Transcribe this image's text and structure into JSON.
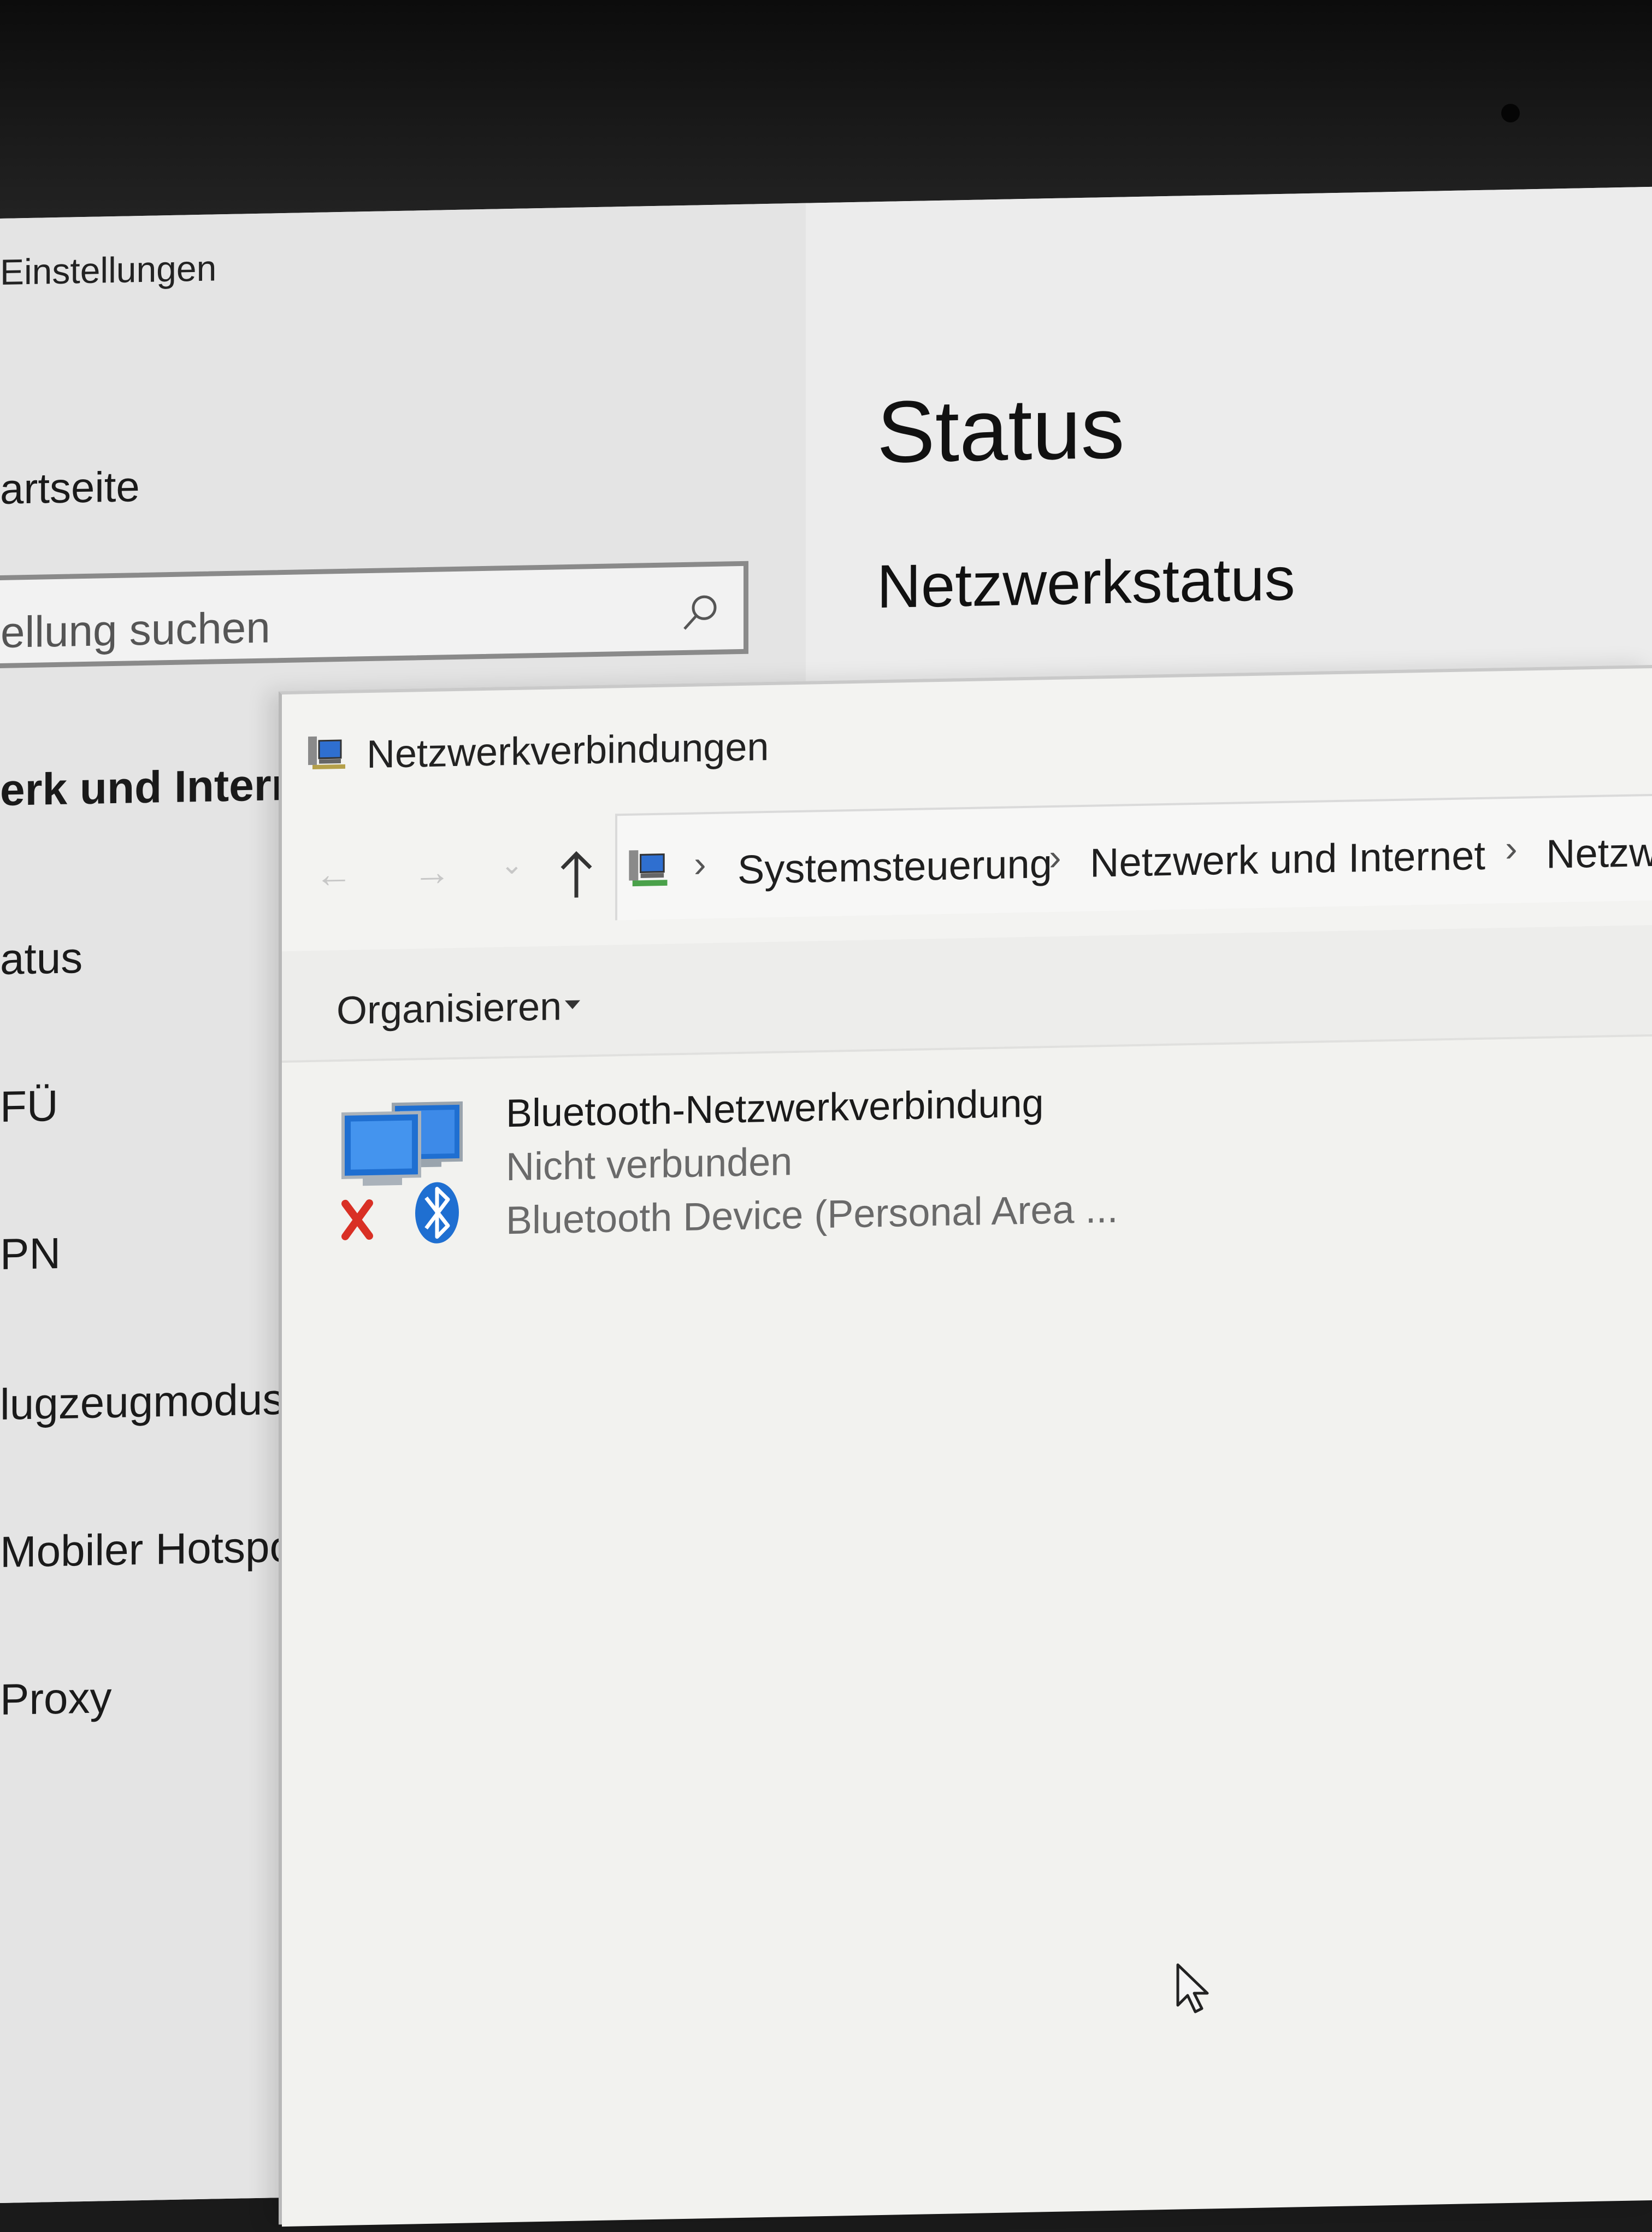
{
  "settings": {
    "title": "Einstellungen",
    "home": "artseite",
    "search_placeholder": "ellung suchen",
    "section": "erk und Interne",
    "nav": [
      "atus",
      "FÜ",
      "PN",
      "lugzeugmodus",
      "Mobiler Hotspot",
      "Proxy"
    ],
    "page_title": "Status",
    "subheading": "Netzwerkstatus"
  },
  "explorer": {
    "title": "Netzwerkverbindungen",
    "breadcrumb": [
      "Systemsteuerung",
      "Netzwerk und Internet",
      "Netzw"
    ],
    "toolbar": {
      "organize_label": "Organisieren"
    },
    "items": [
      {
        "name": "Bluetooth-Netzwerkverbindung",
        "status": "Nicht verbunden",
        "device": "Bluetooth Device (Personal Area ..."
      }
    ]
  },
  "colors": {
    "bluetooth_blue": "#1f6fd1",
    "error_red": "#d93025"
  }
}
